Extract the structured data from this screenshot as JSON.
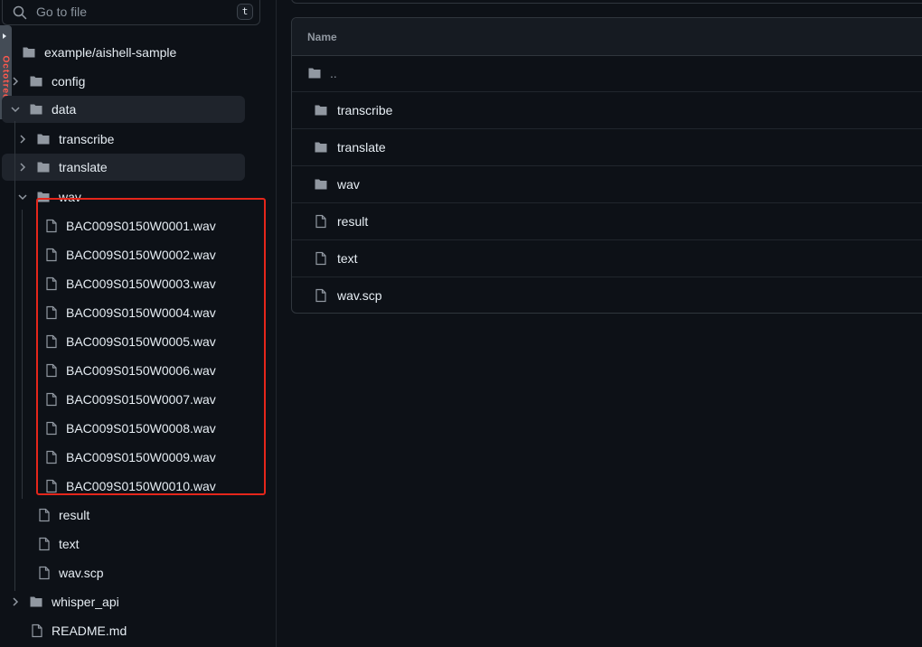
{
  "search": {
    "placeholder": "Go to file",
    "shortcut": "t"
  },
  "side_tab": {
    "text": "Octotree"
  },
  "tree": {
    "root": "example/aishell-sample",
    "config": "config",
    "data": "data",
    "transcribe": "transcribe",
    "translate": "translate",
    "wav": "wav",
    "wav_files": [
      "BAC009S0150W0001.wav",
      "BAC009S0150W0002.wav",
      "BAC009S0150W0003.wav",
      "BAC009S0150W0004.wav",
      "BAC009S0150W0005.wav",
      "BAC009S0150W0006.wav",
      "BAC009S0150W0007.wav",
      "BAC009S0150W0008.wav",
      "BAC009S0150W0009.wav",
      "BAC009S0150W0010.wav"
    ],
    "result": "result",
    "text": "text",
    "wav_scp": "wav.scp",
    "whisper_api": "whisper_api",
    "readme": "README.md"
  },
  "table": {
    "header": "Name",
    "rows": [
      {
        "name": "..",
        "icon": "folder-icon"
      },
      {
        "name": "transcribe",
        "icon": "folder-icon"
      },
      {
        "name": "translate",
        "icon": "folder-icon"
      },
      {
        "name": "wav",
        "icon": "folder-icon"
      },
      {
        "name": "result",
        "icon": "file-icon"
      },
      {
        "name": "text",
        "icon": "file-icon"
      },
      {
        "name": "wav.scp",
        "icon": "file-icon"
      }
    ]
  },
  "colors": {
    "background": "#0d1117",
    "folder": "#9198a1",
    "highlight_border": "#e5261b"
  }
}
